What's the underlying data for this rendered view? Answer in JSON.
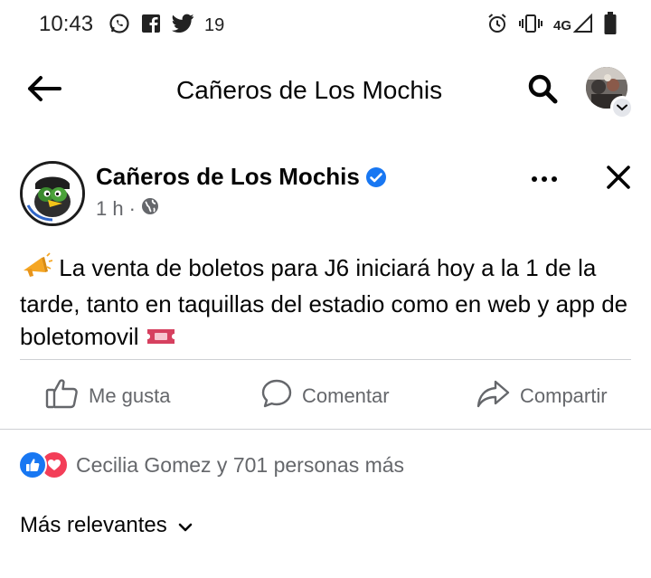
{
  "status_bar": {
    "time": "10:43",
    "notification_count": "19",
    "network": "4G"
  },
  "top_bar": {
    "title": "Cañeros de Los Mochis"
  },
  "post": {
    "author": "Cañeros de Los Mochis",
    "time_ago": "1 h",
    "meta_separator": "·",
    "text_before_emoji": "La venta de boletos para J6 iniciará hoy a la 1 de la tarde, tanto en taquillas del estadio como en web y app de boletomovil",
    "actions": {
      "like": "Me gusta",
      "comment": "Comentar",
      "share": "Compartir"
    },
    "reactions_text": "Cecilia Gomez y 701 personas más"
  },
  "comments": {
    "sort_label": "Más relevantes"
  },
  "colors": {
    "facebook_blue": "#1877f2",
    "love_red": "#f33e58",
    "secondary_text": "#65676b",
    "divider": "#ced0d4"
  }
}
